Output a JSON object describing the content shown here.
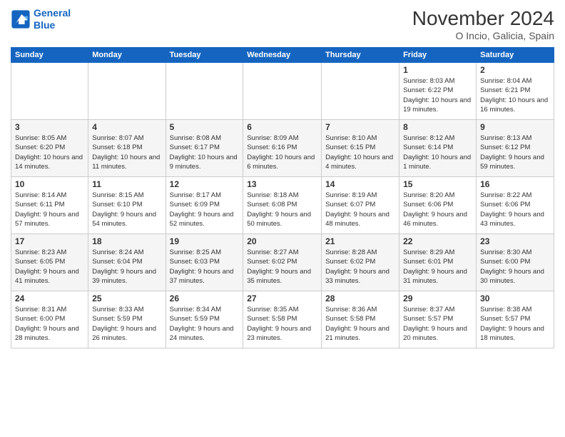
{
  "header": {
    "logo_line1": "General",
    "logo_line2": "Blue",
    "month": "November 2024",
    "location": "O Incio, Galicia, Spain"
  },
  "weekdays": [
    "Sunday",
    "Monday",
    "Tuesday",
    "Wednesday",
    "Thursday",
    "Friday",
    "Saturday"
  ],
  "weeks": [
    [
      {
        "day": "",
        "info": ""
      },
      {
        "day": "",
        "info": ""
      },
      {
        "day": "",
        "info": ""
      },
      {
        "day": "",
        "info": ""
      },
      {
        "day": "",
        "info": ""
      },
      {
        "day": "1",
        "info": "Sunrise: 8:03 AM\nSunset: 6:22 PM\nDaylight: 10 hours and 19 minutes."
      },
      {
        "day": "2",
        "info": "Sunrise: 8:04 AM\nSunset: 6:21 PM\nDaylight: 10 hours and 16 minutes."
      }
    ],
    [
      {
        "day": "3",
        "info": "Sunrise: 8:05 AM\nSunset: 6:20 PM\nDaylight: 10 hours and 14 minutes."
      },
      {
        "day": "4",
        "info": "Sunrise: 8:07 AM\nSunset: 6:18 PM\nDaylight: 10 hours and 11 minutes."
      },
      {
        "day": "5",
        "info": "Sunrise: 8:08 AM\nSunset: 6:17 PM\nDaylight: 10 hours and 9 minutes."
      },
      {
        "day": "6",
        "info": "Sunrise: 8:09 AM\nSunset: 6:16 PM\nDaylight: 10 hours and 6 minutes."
      },
      {
        "day": "7",
        "info": "Sunrise: 8:10 AM\nSunset: 6:15 PM\nDaylight: 10 hours and 4 minutes."
      },
      {
        "day": "8",
        "info": "Sunrise: 8:12 AM\nSunset: 6:14 PM\nDaylight: 10 hours and 1 minute."
      },
      {
        "day": "9",
        "info": "Sunrise: 8:13 AM\nSunset: 6:12 PM\nDaylight: 9 hours and 59 minutes."
      }
    ],
    [
      {
        "day": "10",
        "info": "Sunrise: 8:14 AM\nSunset: 6:11 PM\nDaylight: 9 hours and 57 minutes."
      },
      {
        "day": "11",
        "info": "Sunrise: 8:15 AM\nSunset: 6:10 PM\nDaylight: 9 hours and 54 minutes."
      },
      {
        "day": "12",
        "info": "Sunrise: 8:17 AM\nSunset: 6:09 PM\nDaylight: 9 hours and 52 minutes."
      },
      {
        "day": "13",
        "info": "Sunrise: 8:18 AM\nSunset: 6:08 PM\nDaylight: 9 hours and 50 minutes."
      },
      {
        "day": "14",
        "info": "Sunrise: 8:19 AM\nSunset: 6:07 PM\nDaylight: 9 hours and 48 minutes."
      },
      {
        "day": "15",
        "info": "Sunrise: 8:20 AM\nSunset: 6:06 PM\nDaylight: 9 hours and 46 minutes."
      },
      {
        "day": "16",
        "info": "Sunrise: 8:22 AM\nSunset: 6:06 PM\nDaylight: 9 hours and 43 minutes."
      }
    ],
    [
      {
        "day": "17",
        "info": "Sunrise: 8:23 AM\nSunset: 6:05 PM\nDaylight: 9 hours and 41 minutes."
      },
      {
        "day": "18",
        "info": "Sunrise: 8:24 AM\nSunset: 6:04 PM\nDaylight: 9 hours and 39 minutes."
      },
      {
        "day": "19",
        "info": "Sunrise: 8:25 AM\nSunset: 6:03 PM\nDaylight: 9 hours and 37 minutes."
      },
      {
        "day": "20",
        "info": "Sunrise: 8:27 AM\nSunset: 6:02 PM\nDaylight: 9 hours and 35 minutes."
      },
      {
        "day": "21",
        "info": "Sunrise: 8:28 AM\nSunset: 6:02 PM\nDaylight: 9 hours and 33 minutes."
      },
      {
        "day": "22",
        "info": "Sunrise: 8:29 AM\nSunset: 6:01 PM\nDaylight: 9 hours and 31 minutes."
      },
      {
        "day": "23",
        "info": "Sunrise: 8:30 AM\nSunset: 6:00 PM\nDaylight: 9 hours and 30 minutes."
      }
    ],
    [
      {
        "day": "24",
        "info": "Sunrise: 8:31 AM\nSunset: 6:00 PM\nDaylight: 9 hours and 28 minutes."
      },
      {
        "day": "25",
        "info": "Sunrise: 8:33 AM\nSunset: 5:59 PM\nDaylight: 9 hours and 26 minutes."
      },
      {
        "day": "26",
        "info": "Sunrise: 8:34 AM\nSunset: 5:59 PM\nDaylight: 9 hours and 24 minutes."
      },
      {
        "day": "27",
        "info": "Sunrise: 8:35 AM\nSunset: 5:58 PM\nDaylight: 9 hours and 23 minutes."
      },
      {
        "day": "28",
        "info": "Sunrise: 8:36 AM\nSunset: 5:58 PM\nDaylight: 9 hours and 21 minutes."
      },
      {
        "day": "29",
        "info": "Sunrise: 8:37 AM\nSunset: 5:57 PM\nDaylight: 9 hours and 20 minutes."
      },
      {
        "day": "30",
        "info": "Sunrise: 8:38 AM\nSunset: 5:57 PM\nDaylight: 9 hours and 18 minutes."
      }
    ]
  ]
}
